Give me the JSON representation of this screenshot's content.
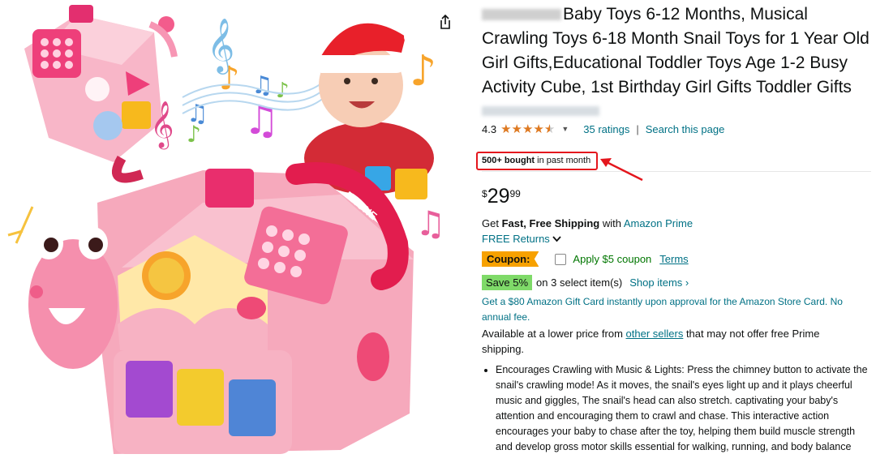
{
  "product": {
    "title": "Baby Toys 6-12 Months, Musical Crawling Toys 6-18 Month Snail Toys for 1 Year Old Girl Gifts,Educational Toddler Toys Age 1-2 Busy Activity Cube, 1st Birthday Girl Gifts Toddler Gifts",
    "rating_value": "4.3",
    "ratings_link": "35 ratings",
    "search_link": "Search this page",
    "bought_bold": "500+ bought",
    "bought_rest": " in past month",
    "price_currency": "$",
    "price_whole": "29",
    "price_fraction": "99",
    "shipping_prefix": "Get ",
    "shipping_bold": "Fast, Free Shipping",
    "shipping_with": " with ",
    "shipping_prime": "Amazon Prime",
    "returns": "FREE Returns",
    "coupon_badge": "Coupon:",
    "coupon_text": "Apply $5 coupon",
    "terms": "Terms",
    "save_badge": "Save 5%",
    "save_text": "on 3 select item(s)",
    "shop_items": "Shop items ›",
    "gift_card": "Get a $80 Amazon Gift Card instantly upon approval for the Amazon Store Card. No annual fee.",
    "avail_prefix": "Available at a lower price from ",
    "avail_link": "other sellers",
    "avail_suffix": " that may not offer free Prime shipping.",
    "bullet_1": "Encourages Crawling with Music & Lights: Press the chimney button to activate the snail's crawling mode! As it moves, the snail's eyes light up and it plays cheerful music and giggles, The snail's head can also stretch. captivating your baby's attention and encouraging them to crawl and chase. This interactive action encourages your baby to chase after the toy, helping them build muscle strength and develop gross motor skills essential for walking, running, and body balance"
  },
  "image": {
    "toy_label": "PHONE"
  },
  "icons": [
    "share-icon",
    "star-icon",
    "chevron-down-icon",
    "red-arrow-annotation"
  ],
  "colors": {
    "link": "#007185",
    "star": "#de7921",
    "coupon": "#f7a100",
    "save": "#7fda69",
    "highlight": "#e4161d",
    "green_text": "#007600"
  }
}
